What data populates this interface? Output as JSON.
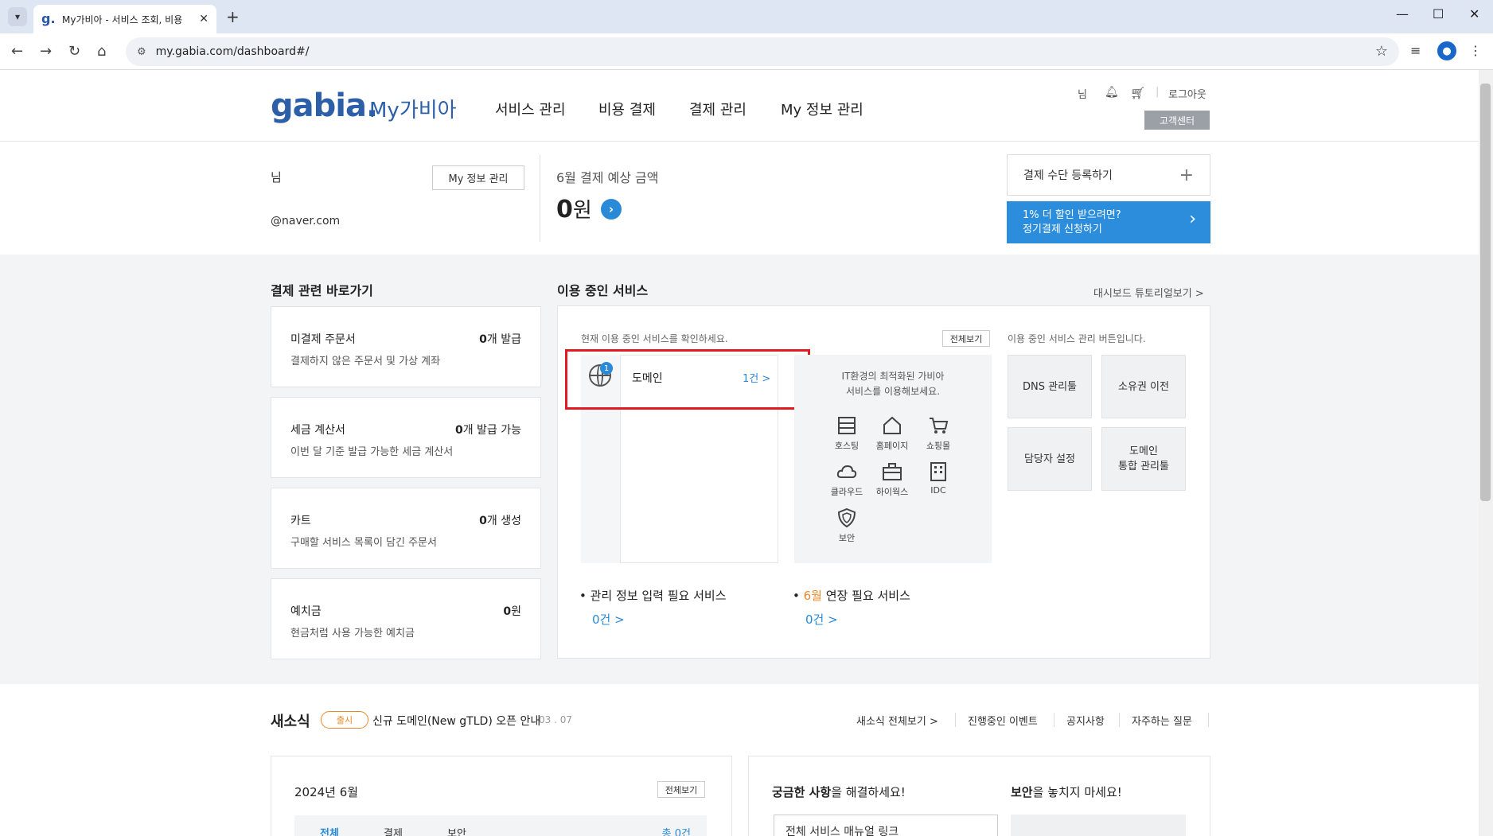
{
  "browser": {
    "tab_title": "My가비아 - 서비스 조회, 비용",
    "url": "my.gabia.com/dashboard#/"
  },
  "header": {
    "logo": "gabia.",
    "logo_sub": "My가비아",
    "nav": [
      "서비스 관리",
      "비용 결제",
      "결제 관리",
      "My 정보 관리"
    ],
    "user_suffix": "님",
    "logout": "로그아웃",
    "customer_center": "고객센터"
  },
  "summary": {
    "name_suffix": "님",
    "email_suffix": "@naver.com",
    "myinfo_button": "My 정보 관리",
    "pay_label": "6월 결제 예상 금액",
    "pay_amount": "0",
    "pay_unit": "원",
    "register_payment": "결제 수단 등록하기",
    "promo_line1": "1% 더 할인 받으려면?",
    "promo_line2": "정기결제 신청하기"
  },
  "shortcuts": {
    "title": "결제 관련 바로가기",
    "items": [
      {
        "title": "미결제 주문서",
        "count": "0",
        "unit": "개 발급",
        "desc": "결제하지 않은 주문서 및 가상 계좌"
      },
      {
        "title": "세금 계산서",
        "count": "0",
        "unit": "개 발급 가능",
        "desc": "이번 달 기준 발급 가능한 세금 계산서"
      },
      {
        "title": "카트",
        "count": "0",
        "unit": "개 생성",
        "desc": "구매할 서비스 목록이 담긴 주문서"
      },
      {
        "title": "예치금",
        "count": "0",
        "unit": "원",
        "desc": "현금처럼 사용 가능한 예치금"
      }
    ]
  },
  "services": {
    "title": "이용 중인 서비스",
    "tutorial_link": "대시보드 튜토리얼보기 >",
    "desc": "현재 이용 중인 서비스를 확인하세요.",
    "view_all": "전체보기",
    "domain_badge": "1",
    "domain_label": "도메인",
    "domain_count": "1건 >",
    "it_msg_line1": "IT환경의 최적화된 가비아",
    "it_msg_line2": "서비스를 이용해보세요.",
    "it_items": [
      "호스팅",
      "홈페이지",
      "쇼핑몰",
      "클라우드",
      "하이웍스",
      "IDC",
      "보안"
    ],
    "mgr_desc": "이용 중인 서비스 관리 버튼입니다.",
    "mgr_buttons": [
      "DNS 관리툴",
      "소유권 이전",
      "담당자 설정",
      "도메인\n통합 관리툴"
    ],
    "need_info": "관리 정보 입력 필요 서비스",
    "need_info_count": "0건 >",
    "renew_month": "6월",
    "renew_label": " 연장 필요 서비스",
    "renew_count": "0건 >"
  },
  "news": {
    "title": "새소식",
    "pill": "출시",
    "headline": "신규 도메인(New gTLD) 오픈 안내",
    "date": "03 . 07",
    "links": [
      "새소식 전체보기 >",
      "진행중인 이벤트",
      "공지사항",
      "자주하는 질문"
    ]
  },
  "bottom": {
    "month": "2024년 6월",
    "view_all": "전체보기",
    "faq_title_b": "궁금한 사항",
    "faq_title_rest": "을 해결하세요!",
    "security_title_b": "보안",
    "security_title_rest": "을 놓치지 마세요!",
    "tabs": [
      "전체",
      "결제",
      "보안"
    ],
    "tab_count": "총 0건",
    "manual_select": "전체 서비스 매뉴얼 링크"
  }
}
